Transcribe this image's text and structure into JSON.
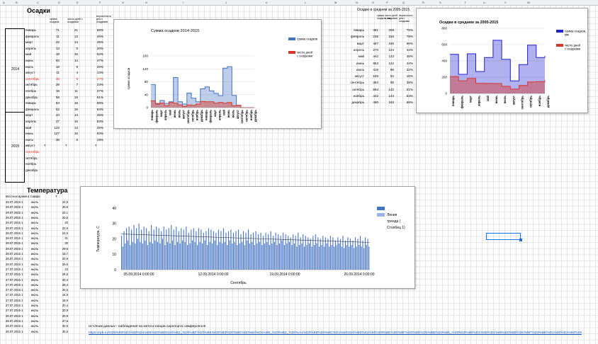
{
  "columns": [
    "A",
    "B",
    "C",
    "D",
    "E",
    "F",
    "G",
    "H",
    "I",
    "J",
    "K",
    "L",
    "M",
    "N",
    "O",
    "P",
    "Q",
    "R",
    "S",
    "T",
    "U",
    "V",
    "W"
  ],
  "precip": {
    "title": "Осадки",
    "headers": [
      "сумма осадков",
      "число дней с осадками",
      "вероятность дня с осадками"
    ],
    "year1": "2014",
    "year2": "2015",
    "rows1": [
      [
        "январь",
        "71",
        "21",
        "68%"
      ],
      [
        "февраль",
        "11",
        "13",
        "46%"
      ],
      [
        "март",
        "22",
        "14",
        "45%"
      ],
      [
        "апрель",
        "13",
        "6",
        "20%"
      ],
      [
        "май",
        "18",
        "16",
        "52%"
      ],
      [
        "июнь",
        "93",
        "14",
        "47%"
      ],
      [
        "июль",
        "18",
        "8",
        "26%"
      ],
      [
        "август",
        "11",
        "4",
        "13%"
      ],
      [
        "сентябрь",
        "45",
        "8",
        "27%"
      ],
      [
        "октябрь",
        "29",
        "7",
        "23%"
      ],
      [
        "ноябрь",
        "18",
        "11",
        "37%"
      ],
      [
        "декабрь",
        "58",
        "19",
        "61%"
      ]
    ],
    "rows2": [
      [
        "январь",
        "64",
        "18",
        "58%"
      ],
      [
        "февраль",
        "52",
        "18",
        "64%"
      ],
      [
        "март",
        "44",
        "14",
        "45%"
      ],
      [
        "апрель",
        "37",
        "16",
        "53%"
      ],
      [
        "май",
        "122",
        "14",
        "45%"
      ],
      [
        "июнь",
        "127",
        "16",
        "53%"
      ],
      [
        "июль",
        "38",
        "6",
        "19%"
      ],
      [
        "август",
        "7",
        "7",
        "7"
      ],
      [
        "сентябрь",
        "",
        "",
        ""
      ],
      [
        "октябрь",
        "",
        "",
        ""
      ],
      [
        "ноябрь",
        "",
        "",
        ""
      ],
      [
        "декабрь",
        "",
        "",
        ""
      ]
    ]
  },
  "avg": {
    "title": "Осадки в среднем за 2005-2015",
    "headers": [
      "сумма осадков, мм",
      "число дней с осадками",
      "вероятность дня с осадками"
    ],
    "rows": [
      [
        "январь",
        "481",
        "208",
        "75%"
      ],
      [
        "февраль",
        "235",
        "156",
        "78%"
      ],
      [
        "март",
        "487",
        "185",
        "66%"
      ],
      [
        "апрель",
        "270",
        "124",
        "44%"
      ],
      [
        "май",
        "442",
        "123",
        "46%"
      ],
      [
        "июнь",
        "653",
        "122",
        "44%"
      ],
      [
        "июль",
        "419",
        "88",
        "32%"
      ],
      [
        "август",
        "155",
        "53",
        "15%"
      ],
      [
        "сентябрь",
        "354",
        "98",
        "36%"
      ],
      [
        "октябрь",
        "594",
        "142",
        "51%"
      ],
      [
        "ноябрь",
        "442",
        "144",
        "53%"
      ],
      [
        "декабрь",
        "460",
        "163",
        "66%"
      ]
    ]
  },
  "temp": {
    "title": "Температура",
    "header": [
      "Местное время в Симфе",
      "T"
    ],
    "rows": [
      [
        "29.07.2015 1",
        "июль",
        "24,9"
      ],
      [
        "29.07.2015 1",
        "июль",
        "25,6"
      ],
      [
        "29.07.2015 1",
        "июль",
        "24,1"
      ],
      [
        "29.07.2015 1",
        "июль",
        "20,5"
      ],
      [
        "29.07.2015 1",
        "июль",
        "20"
      ],
      [
        "28.07.2015 1",
        "июль",
        "22,8"
      ],
      [
        "28.07.2015 1",
        "июль",
        "24,5"
      ],
      [
        "28.07.2015 1",
        "июль",
        "31"
      ],
      [
        "28.07.2015 1",
        "июль",
        "30"
      ],
      [
        "28.07.2015 1",
        "июль",
        "29,6"
      ],
      [
        "28.07.2015 1",
        "июль",
        "18,7"
      ],
      [
        "28.07.2015 1",
        "июль",
        "20,9"
      ],
      [
        "28.07.2015 1",
        "июль",
        "25,6"
      ],
      [
        "27.07.2015 1",
        "июль",
        "23"
      ],
      [
        "27.07.2015 1",
        "июль",
        "26,5"
      ],
      [
        "27.07.2015 1",
        "июль",
        "30,4"
      ],
      [
        "27.07.2015 1",
        "июль",
        "29,4"
      ],
      [
        "27.07.2015 1",
        "июль",
        "25,5"
      ],
      [
        "27.07.2015 1",
        "июль",
        "18,9"
      ],
      [
        "27.07.2015 1",
        "июль",
        "18,9"
      ],
      [
        "27.07.2015 1",
        "июль",
        "20,4"
      ],
      [
        "27.07.2015 1",
        "июль",
        "20,9"
      ],
      [
        "26.07.2015 1",
        "июль",
        "20,9"
      ],
      [
        "26.07.2015 1",
        "июль",
        "27,5"
      ],
      [
        "26.07.2015 1",
        "июль",
        "30,5"
      ],
      [
        "26.07.2015 1",
        "июль",
        "30,5"
      ]
    ]
  },
  "source_text": "источник данных - наблюдения на метеостанции аэропорта симферополя",
  "source_link": "https://rp5.ru/%D0%90%D1%80%D1%85%D0%B8%D0%B2_%D0%BF%D0%BE%D0%B3%D0%BE%D0%B4%D1%8B_%D0%B2_%D0%A1%D0%B8%D0%BC%D1%84%D0%B5%D1%80%D0%BE%D0%BF%D0%BE%D0%BB%D0%B5_%28%D0%B0%D1%8D%D1%80%D0%BE%D0%BF%D0%BE%D1%80%D1%82%29",
  "chart_data": [
    {
      "type": "area",
      "title": "Сумма осадков 2014-2015",
      "ylabel": "сумма осадков",
      "ylim": [
        0,
        160
      ],
      "yticks": [
        0,
        40,
        80,
        120,
        160
      ],
      "categories": [
        "январь",
        "февраль",
        "март",
        "апрель",
        "май",
        "июнь",
        "июль",
        "август",
        "сентябрь",
        "октябрь",
        "ноябрь",
        "декабрь",
        "январь",
        "февраль",
        "март",
        "апрель",
        "май",
        "июнь",
        "июль",
        "август",
        "сентябрь",
        "октябрь",
        "ноябрь",
        "декабрь"
      ],
      "series": [
        {
          "name": "сумма осадков",
          "color": "#4472c4",
          "values": [
            71,
            11,
            22,
            13,
            18,
            93,
            18,
            11,
            45,
            29,
            18,
            58,
            64,
            52,
            44,
            37,
            122,
            127,
            38,
            7,
            0,
            0,
            0,
            0
          ]
        },
        {
          "name": "число дней с осадками",
          "color": "#d9372b",
          "values": [
            21,
            13,
            14,
            6,
            16,
            14,
            8,
            4,
            8,
            7,
            11,
            19,
            18,
            18,
            14,
            16,
            14,
            16,
            6,
            7,
            0,
            0,
            0,
            0
          ]
        }
      ],
      "legend": "right"
    },
    {
      "type": "area",
      "title": "Осадки в среднем за 2005-2015",
      "ylim": [
        0,
        800
      ],
      "yticks": [
        0,
        200,
        400,
        600,
        800
      ],
      "categories": [
        "январь",
        "февраль",
        "март",
        "апрель",
        "май",
        "июнь",
        "июль",
        "август",
        "сентябрь",
        "октябрь",
        "ноябрь",
        "декабрь"
      ],
      "series": [
        {
          "name": "сумма осадков, мм",
          "color": "#2020d0",
          "values": [
            481,
            235,
            487,
            270,
            442,
            653,
            419,
            155,
            354,
            594,
            442,
            460
          ]
        },
        {
          "name": "число дней с осадками",
          "color": "#d9372b",
          "values": [
            208,
            156,
            185,
            124,
            123,
            122,
            88,
            53,
            98,
            142,
            144,
            163
          ]
        }
      ],
      "legend": "right"
    },
    {
      "type": "bar",
      "title": "",
      "ylabel": "Температура, С",
      "xlabel": "Сентябрь",
      "ylim": [
        0,
        40
      ],
      "yticks": [
        0,
        10,
        20,
        30,
        40
      ],
      "xticks": [
        "05.09.2014 0:00:00",
        "12.09.2014 0:00:00",
        "19.09.2014 0:00:00",
        "26.09.2014 0:00:00"
      ],
      "series": [
        {
          "name": "",
          "color": "#4472c4",
          "values": [
            22,
            15,
            25,
            17,
            27,
            19,
            28,
            16,
            26,
            18,
            29,
            17,
            27,
            20,
            30,
            18,
            26,
            17,
            28,
            19,
            27,
            16,
            25,
            18,
            29,
            17,
            26,
            19,
            28,
            18,
            27,
            17,
            25,
            20,
            28,
            16,
            26,
            18,
            27,
            17,
            29,
            19,
            26,
            16,
            28,
            18,
            25,
            17,
            27,
            19,
            26,
            18,
            28,
            16,
            24,
            17,
            26,
            19,
            27,
            18,
            25,
            16,
            27,
            18,
            26,
            17,
            24,
            19,
            25,
            16,
            27,
            18,
            26,
            17,
            25,
            19,
            24,
            16,
            26,
            18,
            25,
            17,
            27,
            18,
            24,
            16,
            25,
            19,
            26,
            17,
            24,
            18,
            25,
            16,
            26,
            17,
            23,
            18,
            25,
            16,
            24,
            19,
            26,
            17,
            23,
            18,
            24,
            16,
            25,
            17,
            23,
            18,
            24,
            16,
            22,
            17,
            24,
            18,
            23,
            16,
            25,
            17,
            22,
            18,
            24,
            16,
            23,
            17,
            22,
            19,
            24,
            16,
            23,
            17,
            22,
            18,
            21,
            16,
            23,
            17,
            22,
            15,
            24,
            16,
            21,
            17,
            23,
            15,
            22,
            16,
            21,
            17,
            20,
            15,
            22,
            16,
            23,
            17,
            21,
            15,
            20,
            16,
            22,
            15,
            21,
            17,
            20,
            15,
            22,
            16,
            21,
            15,
            19,
            16,
            21,
            17,
            20,
            15,
            22,
            14,
            19,
            16,
            21,
            15,
            20,
            16,
            19,
            14,
            21,
            15,
            20,
            16,
            22,
            15,
            19,
            14,
            21,
            16,
            20,
            15
          ]
        },
        {
          "name": "Линия тренда ( Столбец 1)",
          "color": "#9bb3e6",
          "values": []
        }
      ],
      "legend": "right"
    }
  ]
}
